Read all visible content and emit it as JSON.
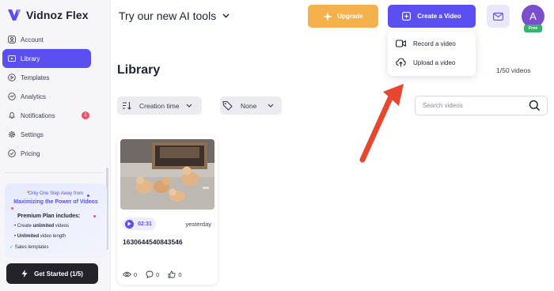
{
  "app": {
    "name": "Vidnoz Flex"
  },
  "sidebar": {
    "items": [
      {
        "label": "Account"
      },
      {
        "label": "Library"
      },
      {
        "label": "Templates"
      },
      {
        "label": "Analytics"
      },
      {
        "label": "Notifications",
        "badge": "1"
      },
      {
        "label": "Settings"
      },
      {
        "label": "Pricing"
      }
    ],
    "promo": {
      "line1": "Only One Step Away from",
      "line2": "Maximizing the Power of Videos",
      "heading": "Premium Plan includes:",
      "features": [
        {
          "bold": "",
          "pre": "Create ",
          "mid": "unlimited",
          "post": " videos"
        },
        {
          "bold": "Unlimited",
          "pre": "",
          "mid": "",
          "post": " video length"
        },
        {
          "bold": "",
          "pre": "Sales templates",
          "mid": "",
          "post": ""
        }
      ]
    },
    "get_started_label": "Get Started (1/5)"
  },
  "header": {
    "promo_text": "Try our new AI tools",
    "upgrade_label": "Upgrade",
    "create_label": "Create a Video",
    "avatar_letter": "A",
    "plan_badge": "Free"
  },
  "create_menu": {
    "items": [
      {
        "label": "Record a video"
      },
      {
        "label": "Upload a video"
      }
    ]
  },
  "library": {
    "title": "Library",
    "count": "1/50 videos",
    "sort_label": "Creation time",
    "tag_filter_label": "None",
    "search_placeholder": "Search videos",
    "videos": [
      {
        "duration": "02:31",
        "date": "yesterday",
        "title": "1630644540843546",
        "views": "0",
        "comments": "0",
        "likes": "0"
      }
    ]
  },
  "colors": {
    "accent": "#5a4ff0",
    "upgrade": "#f3b04b",
    "arrow": "#e8472f",
    "free_badge": "#34b36a"
  }
}
